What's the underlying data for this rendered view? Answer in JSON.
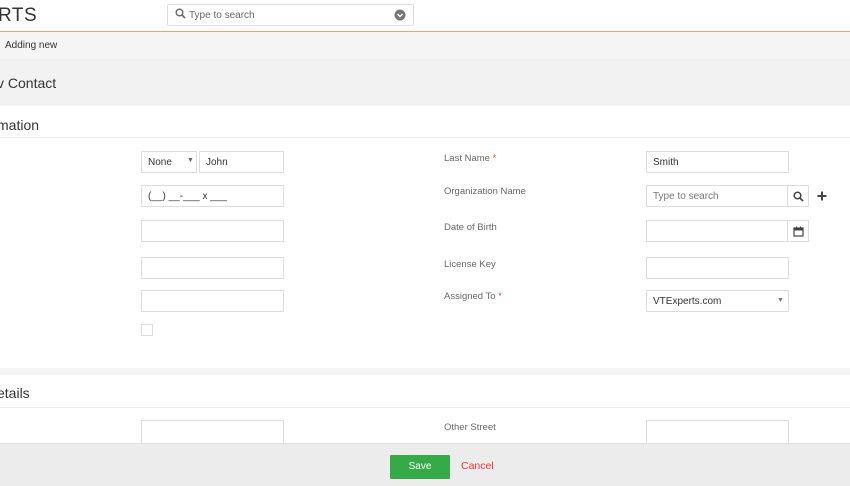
{
  "app": {
    "logo_text": "RTS"
  },
  "search": {
    "placeholder": "Type to search"
  },
  "breadcrumb": {
    "current": "Adding new"
  },
  "page": {
    "title": "v Contact"
  },
  "sections": {
    "basic": {
      "title": "mation"
    },
    "address": {
      "title": "etails"
    }
  },
  "form": {
    "salutation": {
      "value": "None"
    },
    "first_name": {
      "value": "John"
    },
    "phone": {
      "value": "(__) __-___ x ___"
    },
    "last_name": {
      "label": "Last Name",
      "value": "Smith",
      "required_mark": "*"
    },
    "organization": {
      "label": "Organization Name",
      "placeholder": "Type to search"
    },
    "date_of_birth": {
      "label": "Date of Birth"
    },
    "license_key": {
      "label": "License Key"
    },
    "assigned_to": {
      "label": "Assigned To",
      "value": "VTExperts.com",
      "required_mark": "*"
    },
    "other_street": {
      "label": "Other Street"
    }
  },
  "footer": {
    "save_label": "Save",
    "cancel_label": "Cancel"
  },
  "colors": {
    "accent": "#e8a27a",
    "save": "#35aa47",
    "cancel": "#e33333",
    "required": "#e44444"
  }
}
